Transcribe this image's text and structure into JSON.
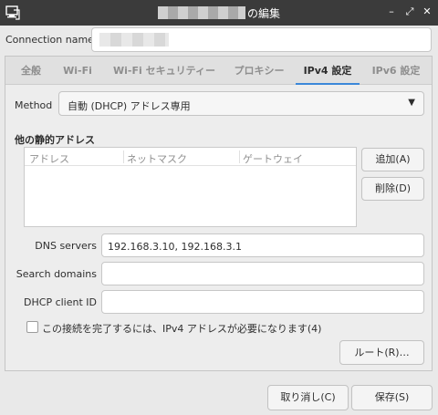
{
  "window": {
    "title": "の編集",
    "controls": {
      "minimize": "–",
      "maximize": "⤢",
      "close": "✕"
    }
  },
  "connection": {
    "label": "Connection name",
    "value": ""
  },
  "tabs": [
    {
      "label": "全般"
    },
    {
      "label": "Wi-Fi"
    },
    {
      "label": "Wi-Fi セキュリティー"
    },
    {
      "label": "プロキシー"
    },
    {
      "label": "IPv4 設定",
      "active": true
    },
    {
      "label": "IPv6 設定"
    }
  ],
  "ipv4": {
    "method_label": "Method",
    "method_value": "自動 (DHCP) アドレス専用",
    "static_title": "他の静的アドレス",
    "columns": [
      "アドレス",
      "ネットマスク",
      "ゲートウェイ"
    ],
    "add_button": "追加(A)",
    "delete_button": "削除(D)",
    "dns_label": "DNS servers",
    "dns_value": "192.168.3.10, 192.168.3.1",
    "search_label": "Search domains",
    "search_value": "",
    "dhcp_label": "DHCP client ID",
    "dhcp_value": "",
    "require_checkbox_label": "この接続を完了するには、IPv4 アドレスが必要になります(4)",
    "require_checked": false,
    "routes_button": "ルート(R)…"
  },
  "footer": {
    "cancel": "取り消し(C)",
    "save": "保存(S)"
  },
  "colors": {
    "titlebar": "#3b3b3b",
    "tab_accent": "#3b87d9"
  }
}
